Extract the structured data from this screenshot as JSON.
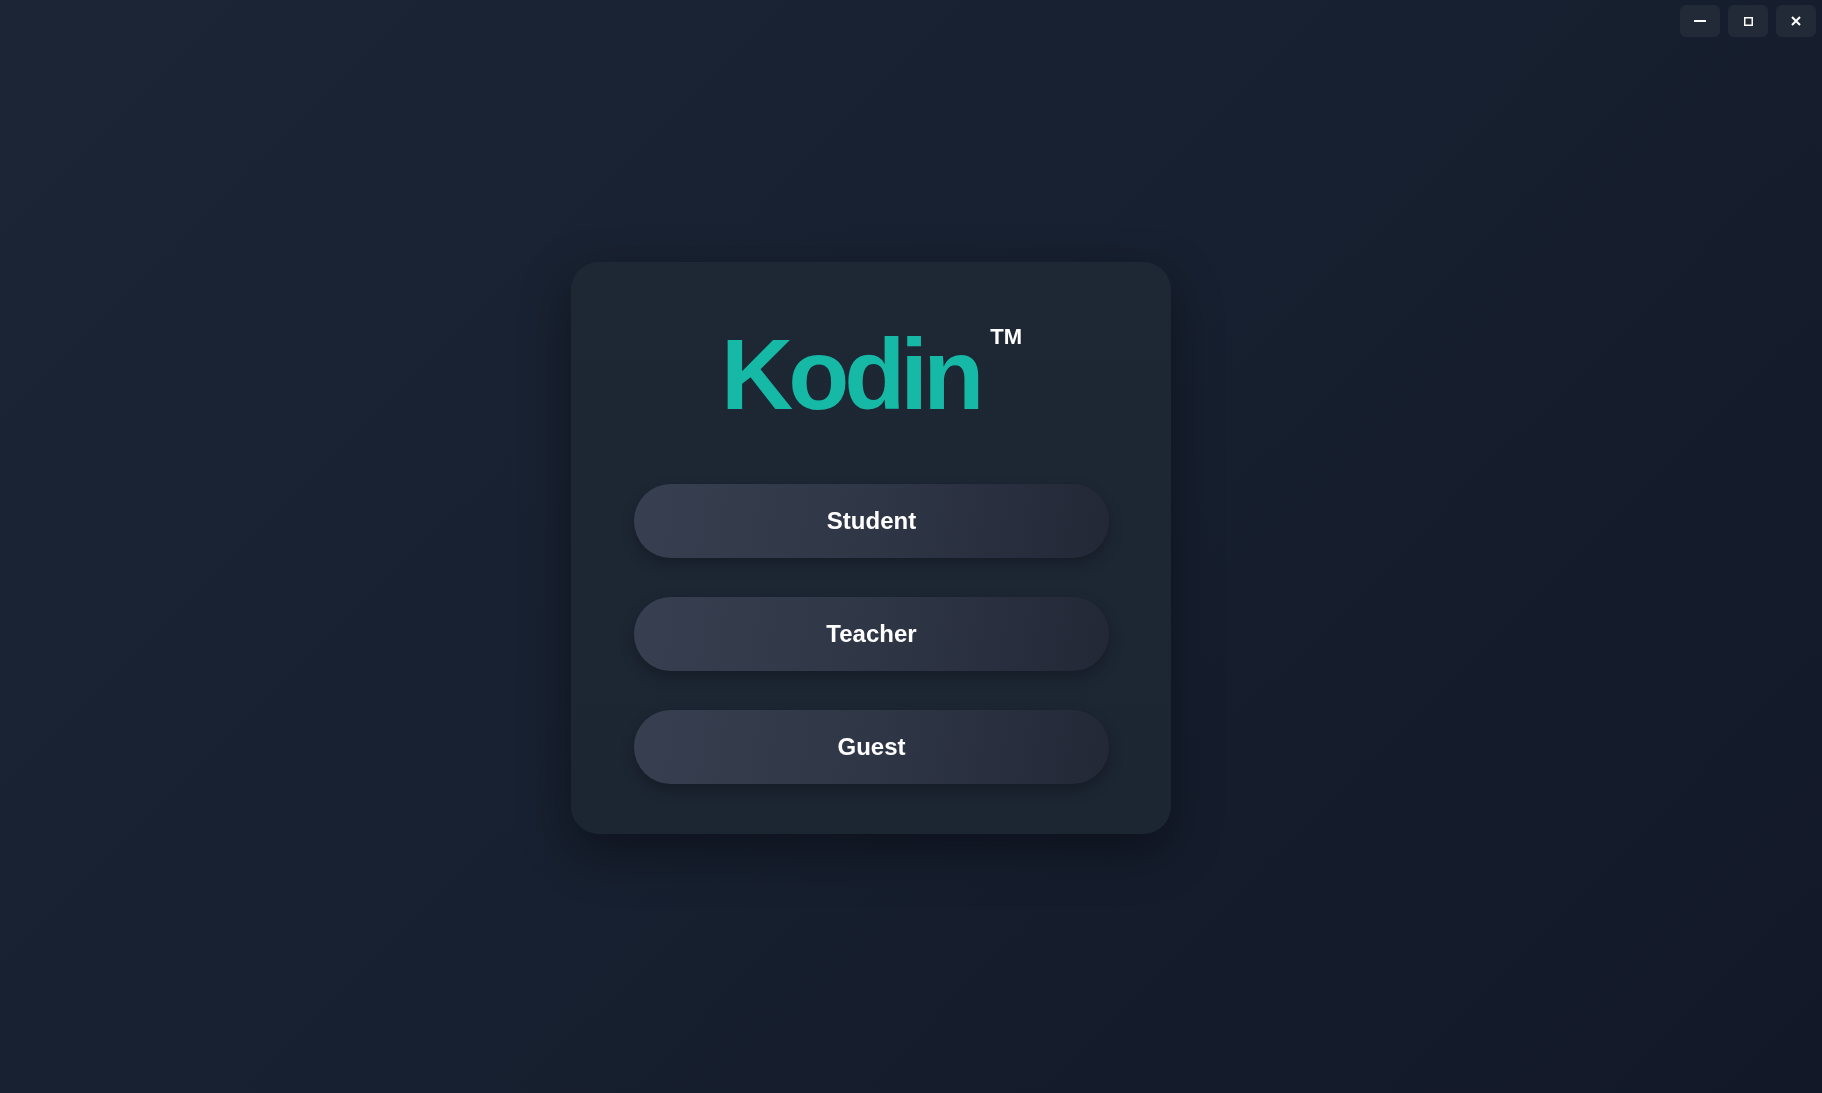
{
  "window_controls": [
    {
      "kind": "minimize"
    },
    {
      "kind": "maximize"
    },
    {
      "kind": "close"
    }
  ],
  "login_card": {
    "title": "Kodin",
    "title_mark": "TM",
    "buttons": [
      "Student",
      "Teacher",
      "Guest"
    ]
  }
}
